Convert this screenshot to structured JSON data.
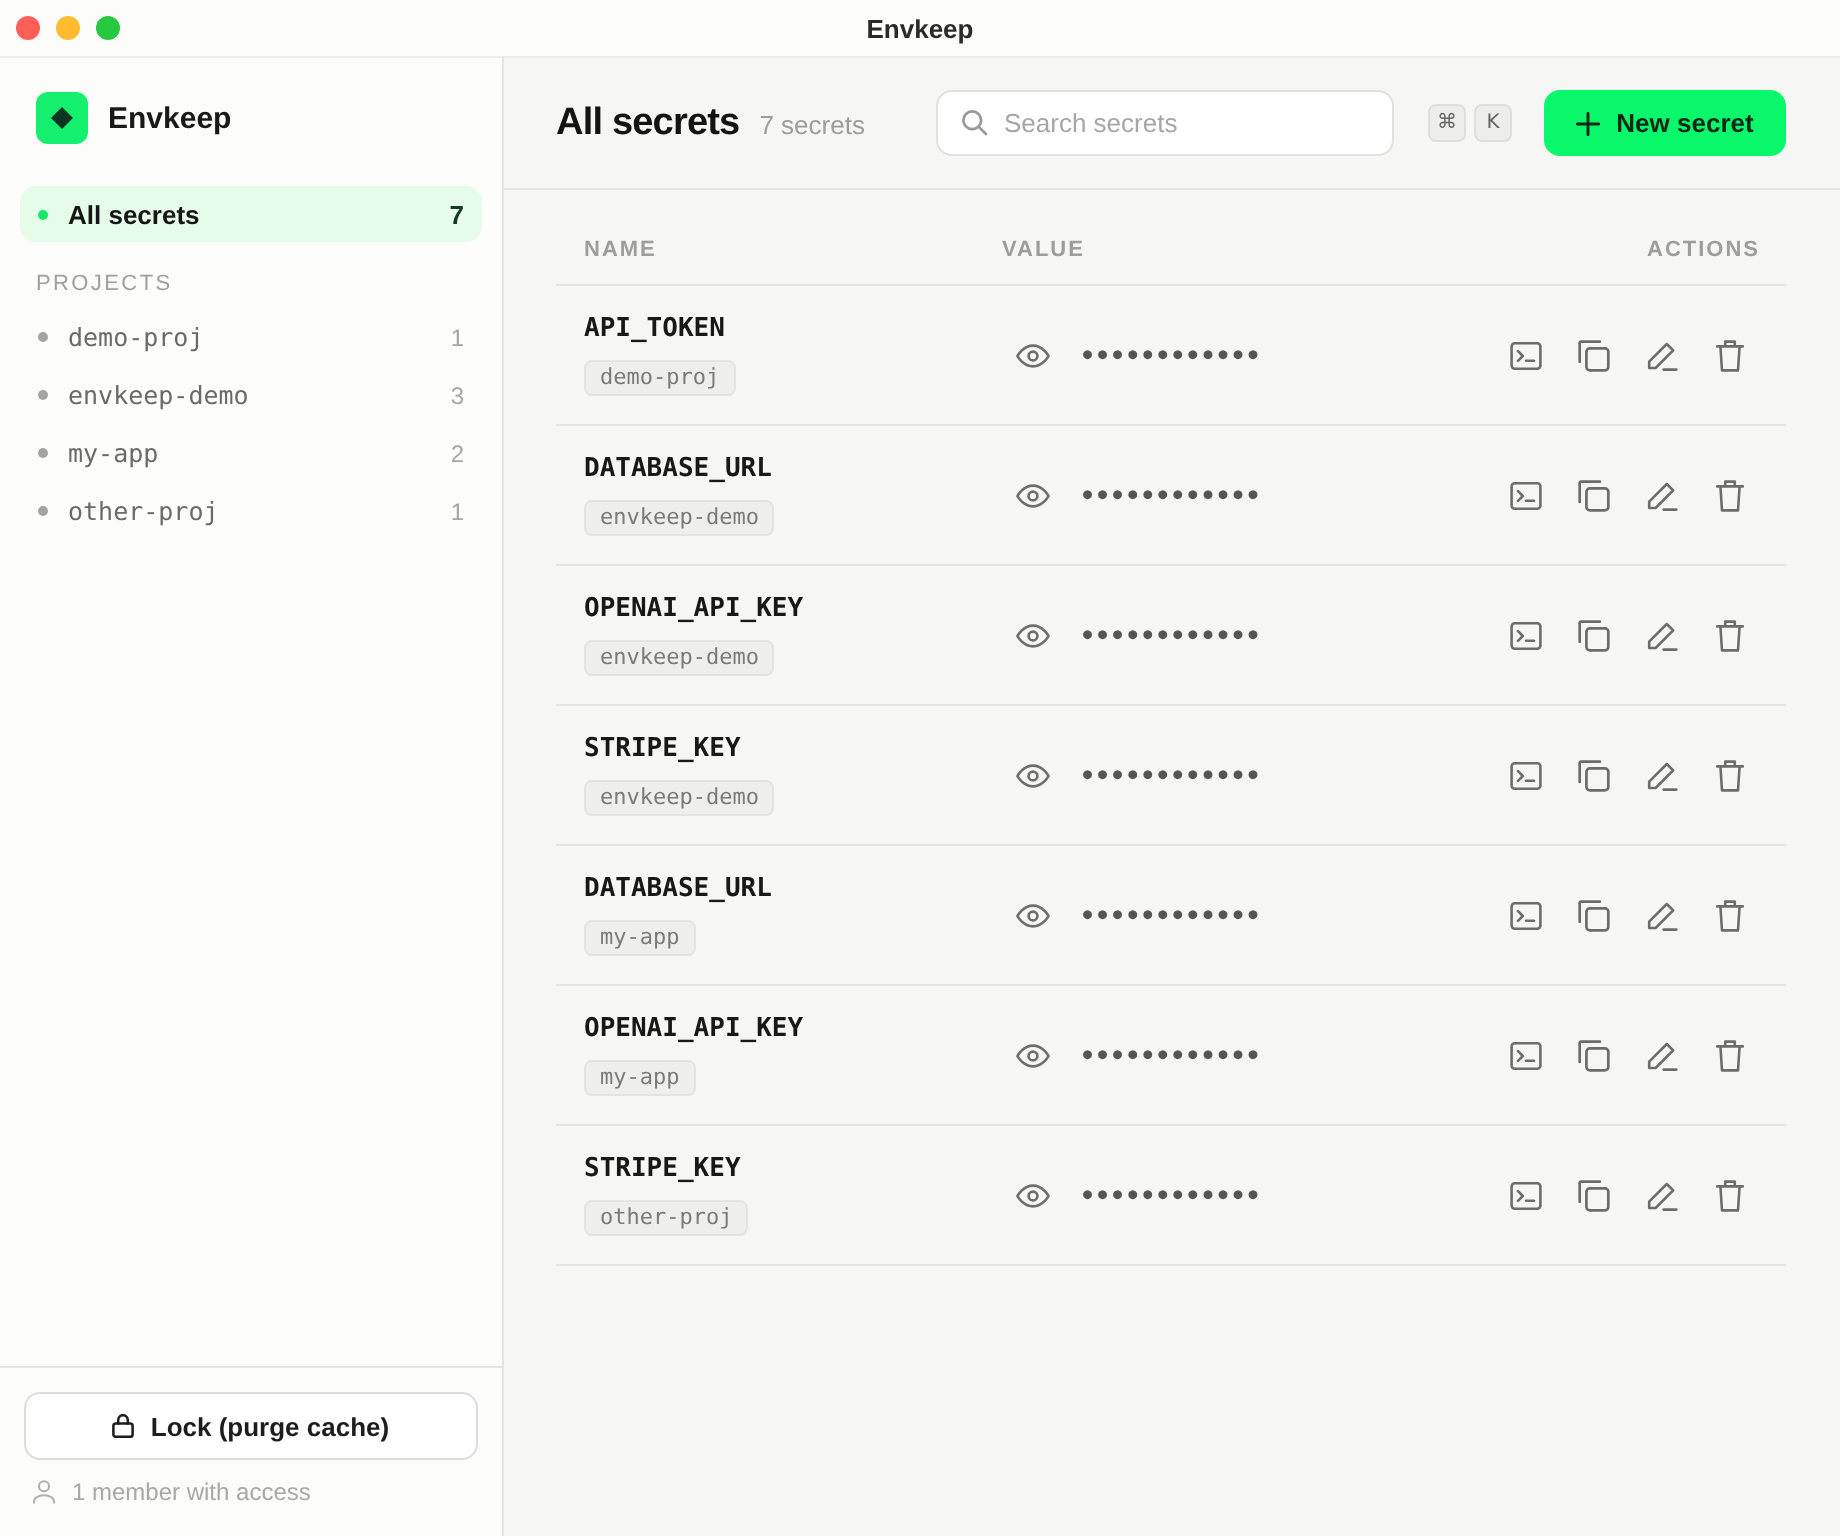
{
  "window": {
    "title": "Envkeep"
  },
  "sidebar": {
    "app_name": "Envkeep",
    "nav": [
      {
        "label": "All secrets",
        "count": "7",
        "selected": true
      }
    ],
    "projects_heading": "PROJECTS",
    "projects": [
      {
        "label": "demo-proj",
        "count": "1",
        "selected": false
      },
      {
        "label": "envkeep-demo",
        "count": "3",
        "selected": false
      },
      {
        "label": "my-app",
        "count": "2",
        "selected": false
      },
      {
        "label": "other-proj",
        "count": "1",
        "selected": false
      }
    ],
    "lock_button": "Lock (purge cache)",
    "members": "1 member with access"
  },
  "header": {
    "title": "All secrets",
    "subtitle": "7 secrets",
    "search": {
      "placeholder": "Search secrets"
    },
    "shortcut": [
      "⌘",
      "K"
    ],
    "new_button": "New secret"
  },
  "table": {
    "columns": [
      "NAME",
      "VALUE",
      "ACTIONS"
    ],
    "rows": [
      {
        "name": "API_TOKEN",
        "project": "demo-proj",
        "value": "••••••••••••"
      },
      {
        "name": "DATABASE_URL",
        "project": "envkeep-demo",
        "value": "••••••••••••"
      },
      {
        "name": "OPENAI_API_KEY",
        "project": "envkeep-demo",
        "value": "••••••••••••"
      },
      {
        "name": "STRIPE_KEY",
        "project": "envkeep-demo",
        "value": "••••••••••••"
      },
      {
        "name": "DATABASE_URL",
        "project": "my-app",
        "value": "••••••••••••"
      },
      {
        "name": "OPENAI_API_KEY",
        "project": "my-app",
        "value": "••••••••••••"
      },
      {
        "name": "STRIPE_KEY",
        "project": "other-proj",
        "value": "••••••••••••"
      }
    ]
  }
}
